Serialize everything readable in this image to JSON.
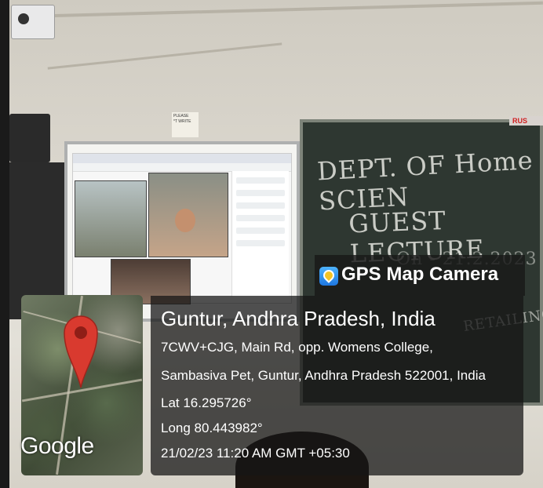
{
  "watermark": {
    "app_name": "GPS Map Camera",
    "app_icon": "gps-map-camera-icon",
    "place": "Guntur, Andhra Pradesh, India",
    "address_line1": "7CWV+CJG, Main Rd, opp. Womens College,",
    "address_line2": "Sambasiva Pet, Guntur, Andhra Pradesh 522001, India",
    "latitude": "Lat 16.295726°",
    "longitude": "Long 80.443982°",
    "datetime": "21/02/23 11:20 AM GMT +05:30",
    "map_brand": "Google",
    "pin_color": "#d93a2f"
  },
  "scene": {
    "chalkboard_line1": "DEPT. OF Home SCIEN",
    "chalkboard_line2": "GUEST LECTURE",
    "chalkboard_line3": "On - 21.2.2023",
    "chalkboard_line4": "RETAILING",
    "notice": "PLEASE\n*T WRITE",
    "board_tag": "RUS"
  }
}
